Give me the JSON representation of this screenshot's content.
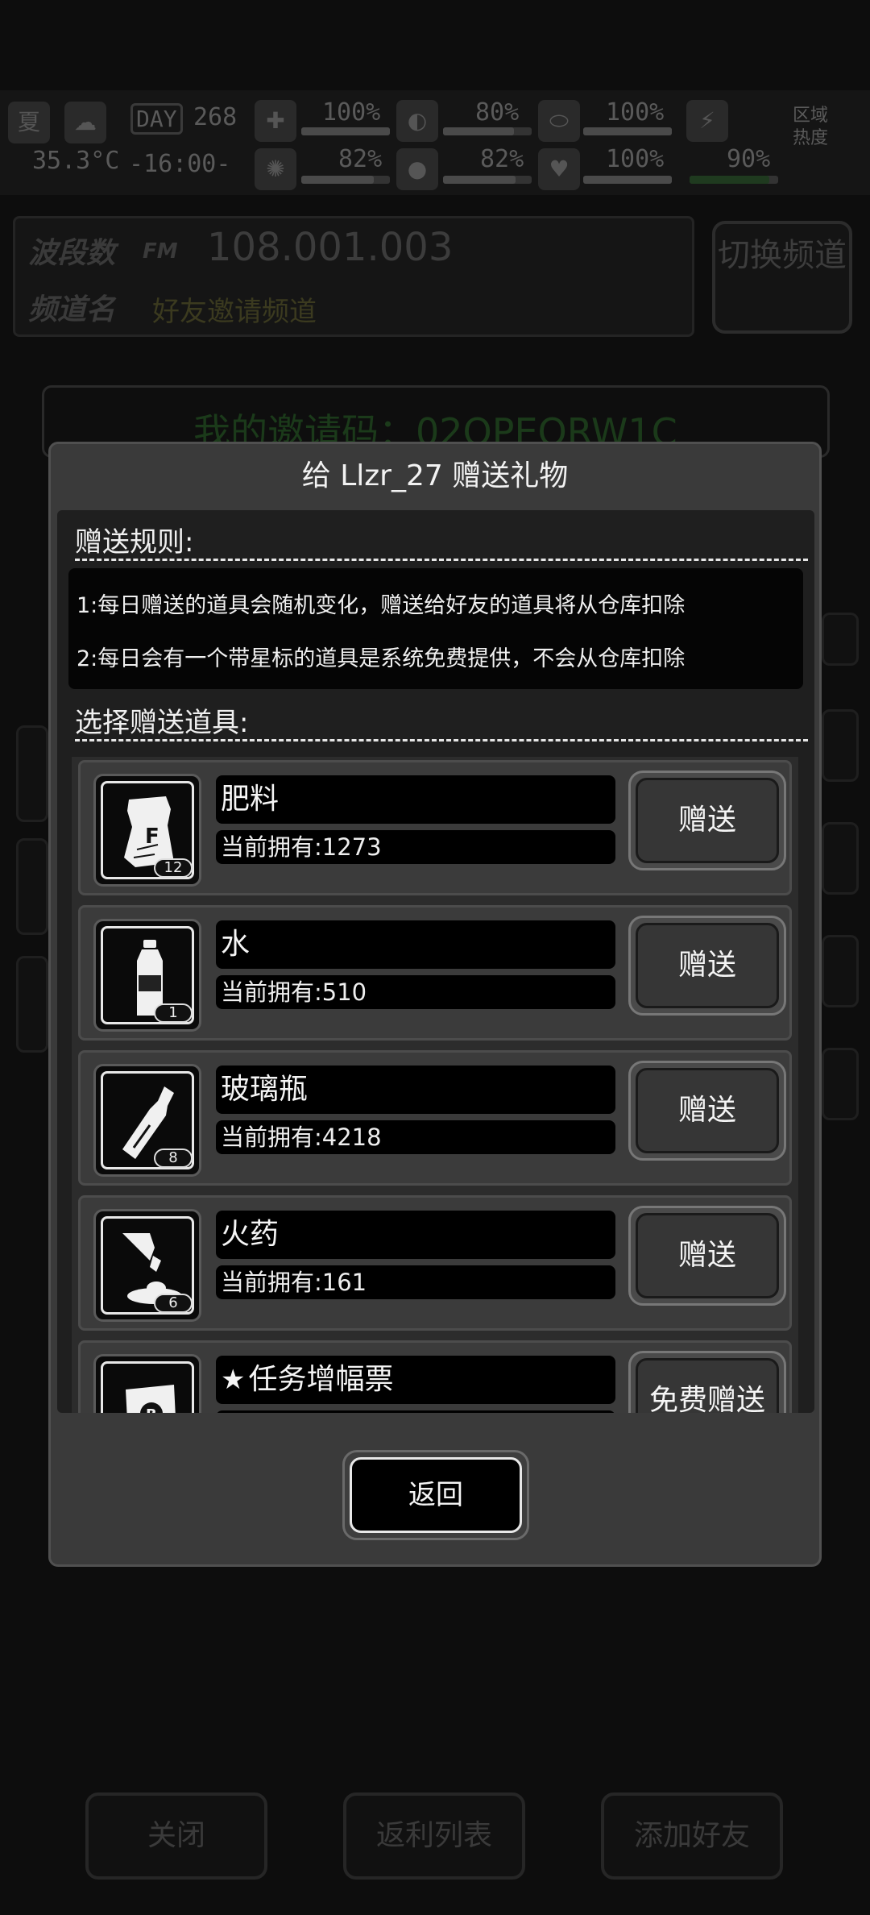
{
  "status": {
    "season": "夏",
    "temperature": "35.3°C",
    "day_label": "DAY",
    "day": "268",
    "time": "-16:00-",
    "stats": [
      {
        "icon": "medkit-icon",
        "value": "100%",
        "fill": 1.0
      },
      {
        "icon": "stomach-icon",
        "value": "80%",
        "fill": 0.8
      },
      {
        "icon": "pill-icon",
        "value": "100%",
        "fill": 1.0
      },
      {
        "icon": "brain-icon",
        "value": "82%",
        "fill": 0.82
      },
      {
        "icon": "water-drop-icon",
        "value": "82%",
        "fill": 0.82
      },
      {
        "icon": "heart-icon",
        "value": "100%",
        "fill": 1.0
      },
      {
        "icon": "stamina-icon",
        "value": "90%",
        "fill": 0.9
      }
    ],
    "region_heat": "区域热度"
  },
  "radio": {
    "band_label": "波段数",
    "fm_label": "FM",
    "band_value": "108.001.003",
    "channel_label": "频道名",
    "channel_value": "好友邀请频道",
    "switch_button": "切换频道"
  },
  "invite": {
    "text": "我的邀请码：02QPEQRW1C"
  },
  "bottom_buttons": {
    "close": "关闭",
    "rebate_list": "返利列表",
    "add_friend": "添加好友"
  },
  "modal": {
    "title": "给 Llzr_27 赠送礼物",
    "rules_title": "赠送规则:",
    "rules": [
      "1:每日赠送的道具会随机变化，赠送给好友的道具将从仓库扣除",
      "2:每日会有一个带星标的道具是系统免费提供，不会从仓库扣除"
    ],
    "select_title": "选择赠送道具:",
    "items": [
      {
        "name": "肥料",
        "count": "当前拥有:1273",
        "badge": "12",
        "icon": "fertilizer-bag-icon",
        "button": "赠送",
        "starred": false
      },
      {
        "name": "水",
        "count": "当前拥有:510",
        "badge": "1",
        "icon": "water-bottle-icon",
        "button": "赠送",
        "starred": false
      },
      {
        "name": "玻璃瓶",
        "count": "当前拥有:4218",
        "badge": "8",
        "icon": "glass-bottle-icon",
        "button": "赠送",
        "starred": false
      },
      {
        "name": "火药",
        "count": "当前拥有:161",
        "badge": "6",
        "icon": "gunpowder-icon",
        "button": "赠送",
        "starred": false
      },
      {
        "name": "任务增幅票",
        "count": "",
        "badge": "",
        "icon": "task-ticket-icon",
        "button": "免费赠送",
        "starred": true
      }
    ],
    "back_button": "返回"
  }
}
